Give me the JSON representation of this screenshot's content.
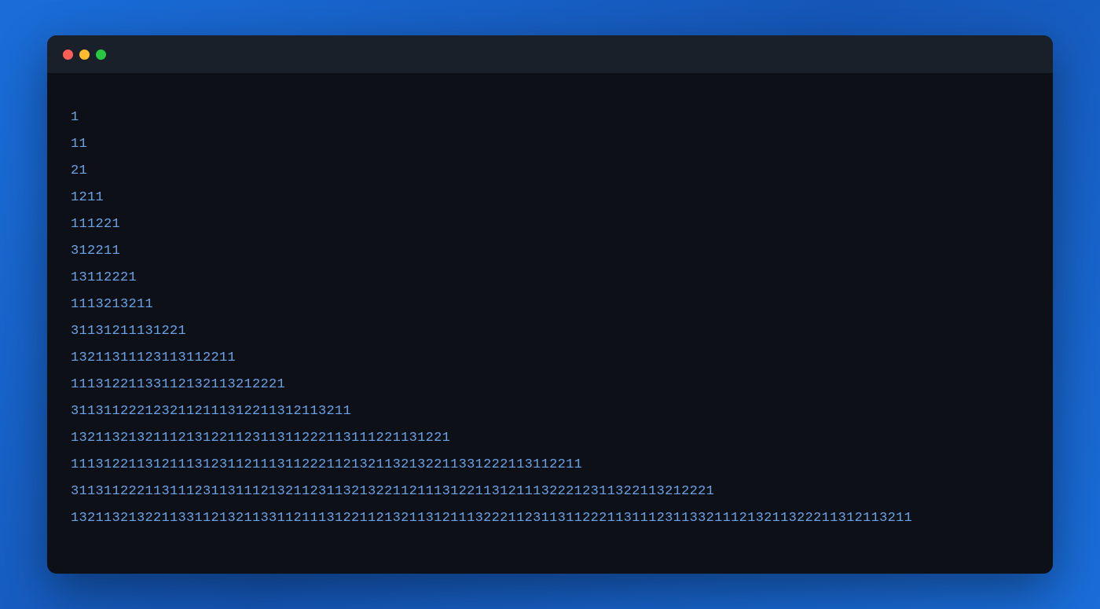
{
  "terminal": {
    "lines": [
      "1",
      "11",
      "21",
      "1211",
      "111221",
      "312211",
      "13112221",
      "1113213211",
      "31131211131221",
      "13211311123113112211",
      "11131221133112132113212221",
      "3113112221232112111312211312113211",
      "1321132132111213122112311311222113111221131221",
      "11131221131211131231121113112221121321132132211331222113112211",
      "311311222113111231131112132112311321322112111312211312111322212311322113212221",
      "132113213221133112132113311211131221121321131211132221123113112221131112311332111213211322211312113211"
    ]
  }
}
